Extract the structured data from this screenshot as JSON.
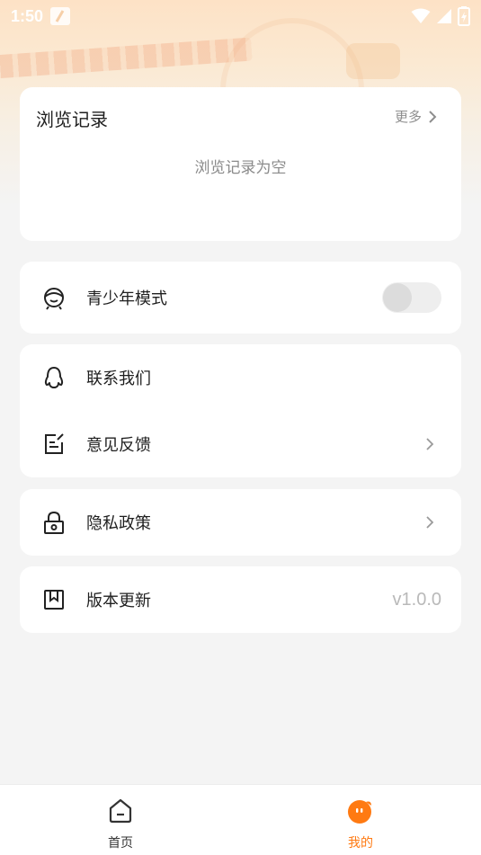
{
  "status_bar": {
    "time": "1:50"
  },
  "history": {
    "title": "浏览记录",
    "more_label": "更多",
    "empty_text": "浏览记录为空"
  },
  "menu": {
    "youth_mode": {
      "label": "青少年模式",
      "enabled": false
    },
    "contact": {
      "label": "联系我们"
    },
    "feedback": {
      "label": "意见反馈"
    },
    "privacy": {
      "label": "隐私政策"
    },
    "version": {
      "label": "版本更新",
      "value": "v1.0.0"
    }
  },
  "bottom_nav": {
    "items": [
      {
        "label": "首页",
        "icon": "home-icon",
        "active": false
      },
      {
        "label": "我的",
        "icon": "profile-face-icon",
        "active": true
      }
    ]
  },
  "colors": {
    "accent": "#ff7a12",
    "inactive_text": "#333333",
    "background": "#f4f4f4"
  }
}
